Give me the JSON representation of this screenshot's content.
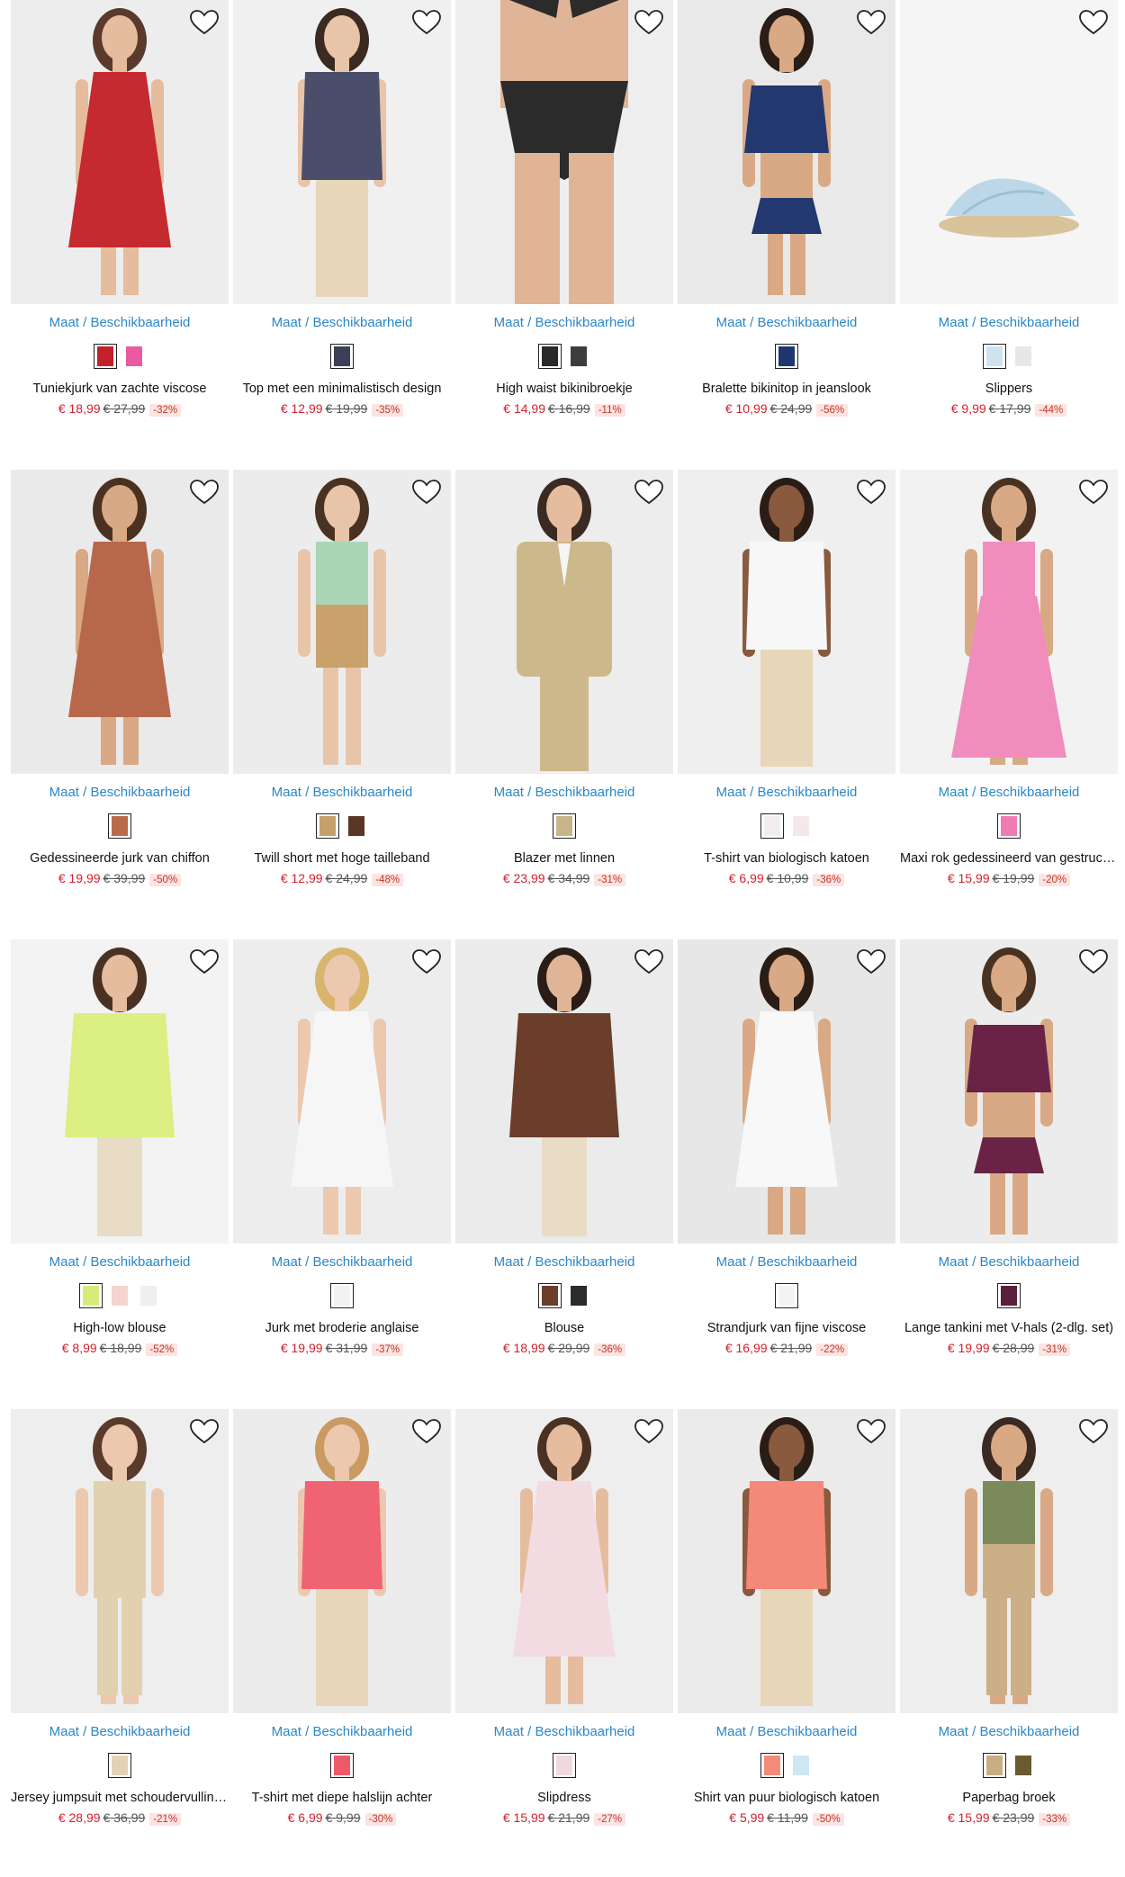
{
  "size_link_label": "Maat / Beschikbaarheid",
  "colors": {
    "link": "#2a87c8",
    "sale_price": "#d4202c",
    "discount_bg": "#fde3e1"
  },
  "rows": [
    [
      {
        "name": "Tuniekjurk van zachte viscose",
        "price": "€ 18,99",
        "old_price": "€ 27,99",
        "discount": "-32%",
        "swatches": [
          "#c4202b",
          "#e85ba0"
        ],
        "garment": "#c52a30",
        "skin": "#e6bc9e",
        "hair": "#5a3a2a",
        "bg": "#ededed",
        "type": "dress"
      },
      {
        "name": "Top met een minimalistisch design",
        "price": "€ 12,99",
        "old_price": "€ 19,99",
        "discount": "-35%",
        "swatches": [
          "#3b3f58"
        ],
        "garment": "#4a4e6a",
        "skin": "#e8c4a8",
        "hair": "#3a2a22",
        "bg": "#f0f0f0",
        "type": "top"
      },
      {
        "name": "High waist bikinibroekje",
        "price": "€ 14,99",
        "old_price": "€ 16,99",
        "discount": "-11%",
        "swatches": [
          "#2a2a2a",
          "#3d3d3d"
        ],
        "garment": "#2b2b2b",
        "skin": "#e0b496",
        "hair": "#3a2a22",
        "bg": "#eeeeee",
        "type": "bikini"
      },
      {
        "name": "Bralette bikinitop in jeanslook",
        "price": "€ 10,99",
        "old_price": "€ 24,99",
        "discount": "-56%",
        "swatches": [
          "#1f3770"
        ],
        "garment": "#23386f",
        "skin": "#d9a985",
        "hair": "#2a1d16",
        "bg": "#e9e9e9",
        "type": "crop"
      },
      {
        "name": "Slippers",
        "price": "€ 9,99",
        "old_price": "€ 17,99",
        "discount": "-44%",
        "swatches": [
          "#cfe3ee",
          "#e7e7e7"
        ],
        "garment": "#bcd8e8",
        "skin": "#e6bc9e",
        "hair": "#5a3a2a",
        "bg": "#f5f5f5",
        "type": "shoe"
      }
    ],
    [
      {
        "name": "Gedessineerde jurk van chiffon",
        "price": "€ 19,99",
        "old_price": "€ 39,99",
        "discount": "-50%",
        "swatches": [
          "#b86a4a"
        ],
        "garment": "#b8684a",
        "skin": "#d9a985",
        "hair": "#4a3222",
        "bg": "#eaeaea",
        "type": "dress"
      },
      {
        "name": "Twill short met hoge tailleband",
        "price": "€ 12,99",
        "old_price": "€ 24,99",
        "discount": "-48%",
        "swatches": [
          "#c4a06a",
          "#5a3626"
        ],
        "garment": "#c9a26b",
        "skin": "#e8c4a8",
        "hair": "#4a3222",
        "bg": "#ececec",
        "type": "shorts"
      },
      {
        "name": "Blazer met linnen",
        "price": "€ 23,99",
        "old_price": "€ 34,99",
        "discount": "-31%",
        "swatches": [
          "#c8b48a"
        ],
        "garment": "#cdb88c",
        "skin": "#e6bc9e",
        "hair": "#3a2a22",
        "bg": "#ededed",
        "type": "blazer"
      },
      {
        "name": "T-shirt van biologisch katoen",
        "price": "€ 6,99",
        "old_price": "€ 10,99",
        "discount": "-36%",
        "swatches": [
          "#f3eded",
          "#f6e8e8"
        ],
        "garment": "#f7f7f7",
        "skin": "#8a5a3e",
        "hair": "#2a1d16",
        "bg": "#efefef",
        "type": "top"
      },
      {
        "name": "Maxi rok gedessineerd van gestructureerd materiaal",
        "price": "€ 15,99",
        "old_price": "€ 19,99",
        "discount": "-20%",
        "swatches": [
          "#f07ab2"
        ],
        "garment": "#f08dbd",
        "skin": "#d9a985",
        "hair": "#4a3222",
        "bg": "#f2f2f2",
        "type": "skirt"
      }
    ],
    [
      {
        "name": "High-low blouse",
        "price": "€ 8,99",
        "old_price": "€ 18,99",
        "discount": "-52%",
        "swatches": [
          "#d6ec7a",
          "#f5d3cf",
          "#efefef"
        ],
        "garment": "#dcef82",
        "skin": "#e6bc9e",
        "hair": "#4a3222",
        "bg": "#f3f3f3",
        "type": "blouse"
      },
      {
        "name": "Jurk met broderie anglaise",
        "price": "€ 19,99",
        "old_price": "€ 31,99",
        "discount": "-37%",
        "swatches": [
          "#f2f2f2"
        ],
        "garment": "#f6f6f6",
        "skin": "#ecc8ae",
        "hair": "#d9b46c",
        "bg": "#ededed",
        "type": "dress"
      },
      {
        "name": "Blouse",
        "price": "€ 18,99",
        "old_price": "€ 29,99",
        "discount": "-36%",
        "swatches": [
          "#6a3e2a",
          "#2b2b2b"
        ],
        "garment": "#6a3e2a",
        "skin": "#e0b496",
        "hair": "#2a1d16",
        "bg": "#ebebeb",
        "type": "blouse"
      },
      {
        "name": "Strandjurk van fijne viscose",
        "price": "€ 16,99",
        "old_price": "€ 21,99",
        "discount": "-22%",
        "swatches": [
          "#f4f4f4"
        ],
        "garment": "#f8f8f8",
        "skin": "#d9a985",
        "hair": "#2a1d16",
        "bg": "#e7e7e7",
        "type": "dress"
      },
      {
        "name": "Lange tankini met V-hals (2-dlg. set)",
        "price": "€ 19,99",
        "old_price": "€ 28,99",
        "discount": "-31%",
        "swatches": [
          "#5a1f3a"
        ],
        "garment": "#6a2346",
        "skin": "#d9a985",
        "hair": "#4a3222",
        "bg": "#ececec",
        "type": "crop"
      }
    ],
    [
      {
        "name": "Jersey jumpsuit met schoudervullingen",
        "price": "€ 28,99",
        "old_price": "€ 36,99",
        "discount": "-21%",
        "swatches": [
          "#e3d3b5"
        ],
        "garment": "#e2d1b0",
        "skin": "#ecc8ae",
        "hair": "#5a3a2a",
        "bg": "#eeeeee",
        "type": "jumpsuit"
      },
      {
        "name": "T-shirt met diepe halslijn achter",
        "price": "€ 6,99",
        "old_price": "€ 9,99",
        "discount": "-30%",
        "swatches": [
          "#ef5a6a"
        ],
        "garment": "#f06372",
        "skin": "#ecc8ae",
        "hair": "#c99a62",
        "bg": "#ececec",
        "type": "top"
      },
      {
        "name": "Slipdress",
        "price": "€ 15,99",
        "old_price": "€ 21,99",
        "discount": "-27%",
        "swatches": [
          "#f0d8de"
        ],
        "garment": "#f3dbe2",
        "skin": "#e6bc9e",
        "hair": "#4a3222",
        "bg": "#eeeeee",
        "type": "dress"
      },
      {
        "name": "Shirt van puur biologisch katoen",
        "price": "€ 5,99",
        "old_price": "€ 11,99",
        "discount": "-50%",
        "swatches": [
          "#f48a7a",
          "#cfe6f3"
        ],
        "garment": "#f4897a",
        "skin": "#8a5a3e",
        "hair": "#2a1d16",
        "bg": "#ebebeb",
        "type": "top"
      },
      {
        "name": "Paperbag broek",
        "price": "€ 15,99",
        "old_price": "€ 23,99",
        "discount": "-33%",
        "swatches": [
          "#c8ad82",
          "#6a5a32"
        ],
        "garment": "#cbb087",
        "skin": "#d9a985",
        "hair": "#3a2a22",
        "bg": "#eeeeee",
        "type": "pants"
      }
    ]
  ]
}
